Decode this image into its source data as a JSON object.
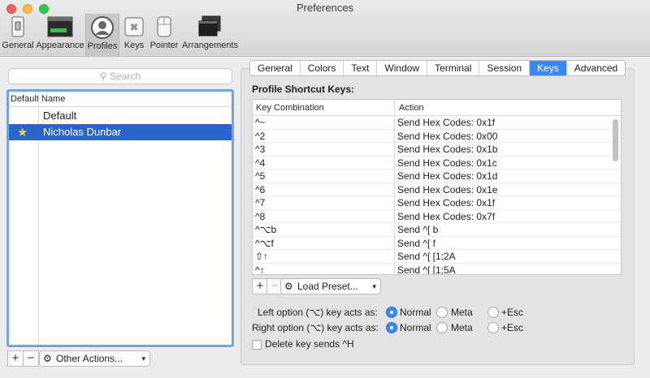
{
  "window": {
    "title": "Preferences"
  },
  "toolbar": {
    "items": [
      {
        "label": "General",
        "icon": "switch-icon"
      },
      {
        "label": "Appearance",
        "icon": "appearance-icon"
      },
      {
        "label": "Profiles",
        "icon": "profile-icon",
        "active": true
      },
      {
        "label": "Keys",
        "icon": "keyboard-icon"
      },
      {
        "label": "Pointer",
        "icon": "mouse-icon"
      },
      {
        "label": "Arrangements",
        "icon": "windows-icon"
      }
    ]
  },
  "profiles": {
    "search_placeholder": "Search",
    "col_default": "Default",
    "col_name": "Name",
    "rows": [
      {
        "name": "Default",
        "is_default": false,
        "selected": false
      },
      {
        "name": "Nicholas Dunbar",
        "is_default": true,
        "selected": true
      }
    ],
    "add_label": "+",
    "remove_label": "−",
    "other_actions_label": "Other Actions..."
  },
  "tabs": [
    "General",
    "Colors",
    "Text",
    "Window",
    "Terminal",
    "Session",
    "Keys",
    "Advanced"
  ],
  "active_tab": "Keys",
  "keys": {
    "section_title": "Profile Shortcut Keys:",
    "col_combo": "Key Combination",
    "col_action": "Action",
    "rows": [
      {
        "combo": "^~",
        "action": "Send Hex Codes: 0x1f"
      },
      {
        "combo": "^2",
        "action": "Send Hex Codes: 0x00"
      },
      {
        "combo": "^3",
        "action": "Send Hex Codes: 0x1b"
      },
      {
        "combo": "^4",
        "action": "Send Hex Codes: 0x1c"
      },
      {
        "combo": "^5",
        "action": "Send Hex Codes: 0x1d"
      },
      {
        "combo": "^6",
        "action": "Send Hex Codes: 0x1e"
      },
      {
        "combo": "^7",
        "action": "Send Hex Codes: 0x1f"
      },
      {
        "combo": "^8",
        "action": "Send Hex Codes: 0x7f"
      },
      {
        "combo": "^⌥b",
        "action": "Send ^[ b"
      },
      {
        "combo": "^⌥f",
        "action": "Send ^[ f"
      },
      {
        "combo": "⇧↑",
        "action": "Send ^[ [1;2A"
      },
      {
        "combo": "^↑",
        "action": "Send ^[ [1;5A"
      }
    ],
    "add_label": "+",
    "remove_label": "−",
    "load_preset_label": "Load Preset..."
  },
  "options": {
    "left_label": "Left option (⌥) key acts as:",
    "right_label": "Right option (⌥) key acts as:",
    "choices": [
      "Normal",
      "Meta",
      "+Esc"
    ],
    "left_selected": "Normal",
    "right_selected": "Normal",
    "delete_label": "Delete key sends ^H",
    "delete_checked": false
  },
  "colors": {
    "accent": "#3b88f5",
    "selection": "#2b63cf",
    "focus_ring": "#6fa5e6"
  }
}
